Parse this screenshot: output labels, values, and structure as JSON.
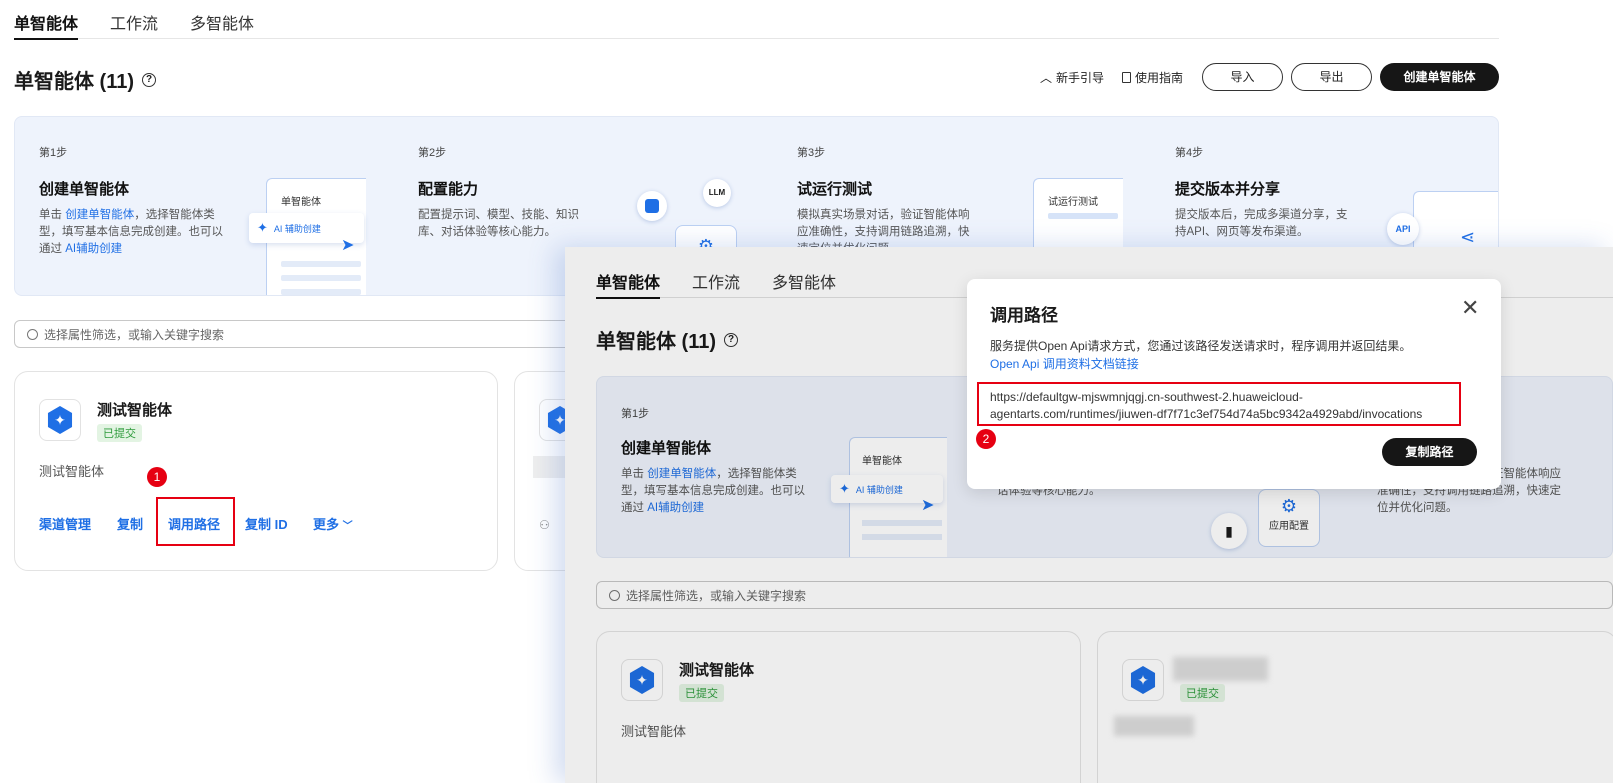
{
  "tabs": [
    "单智能体",
    "工作流",
    "多智能体"
  ],
  "page": {
    "title": "单智能体 (11)",
    "help_icon": "question-circle-icon",
    "guide_label": "新手引导",
    "manual_label": "使用指南",
    "import_label": "导入",
    "export_label": "导出",
    "create_label": "创建单智能体"
  },
  "steps": [
    {
      "label": "第1步",
      "title": "创建单智能体",
      "desc_pre": "单击",
      "desc_link": "创建单智能体",
      "desc_mid": "，选择智能体类型，填写基本信息完成创建。也可以通过",
      "desc_link2": "AI辅助创建",
      "mini_header": "单智能体",
      "mini_ai": "AI 辅助创建"
    },
    {
      "label": "第2步",
      "title": "配置能力",
      "desc": "配置提示词、模型、技能、知识库、对话体验等核心能力。",
      "llm": "LLM",
      "app_config": "应用配置"
    },
    {
      "label": "第3步",
      "title": "试运行测试",
      "desc": "模拟真实场景对话，验证智能体响应准确性，支持调用链路追溯，快速定位并优化问题。",
      "mini_header": "试运行测试"
    },
    {
      "label": "第4步",
      "title": "提交版本并分享",
      "desc": "提交版本后，完成多渠道分享，支持API、网页等发布渠道。",
      "api": "API"
    }
  ],
  "search": {
    "placeholder": "选择属性筛选，或输入关键字搜索"
  },
  "card1": {
    "name": "测试智能体",
    "status": "已提交",
    "desc": "测试智能体",
    "actions": {
      "channel": "渠道管理",
      "copy": "复制",
      "invoke_path": "调用路径",
      "copy_id": "复制 ID",
      "more": "更多"
    }
  },
  "card2": {
    "status": "已提交"
  },
  "markers": {
    "one": "1",
    "two": "2"
  },
  "modal": {
    "title": "调用路径",
    "desc": "服务提供Open Api请求方式，您通过该路径发送请求时，程序调用并返回结果。",
    "doc_link": "Open Api 调用资料文档链接",
    "url_line1": "https://defaultgw-mjswmnjqgj.cn-southwest-2.huaweicloud-",
    "url_line2": "agentarts.com/runtimes/jiuwen-df7f71c3ef754d74a5bc9342a4929abd/invocations",
    "copy_label": "复制路径"
  }
}
